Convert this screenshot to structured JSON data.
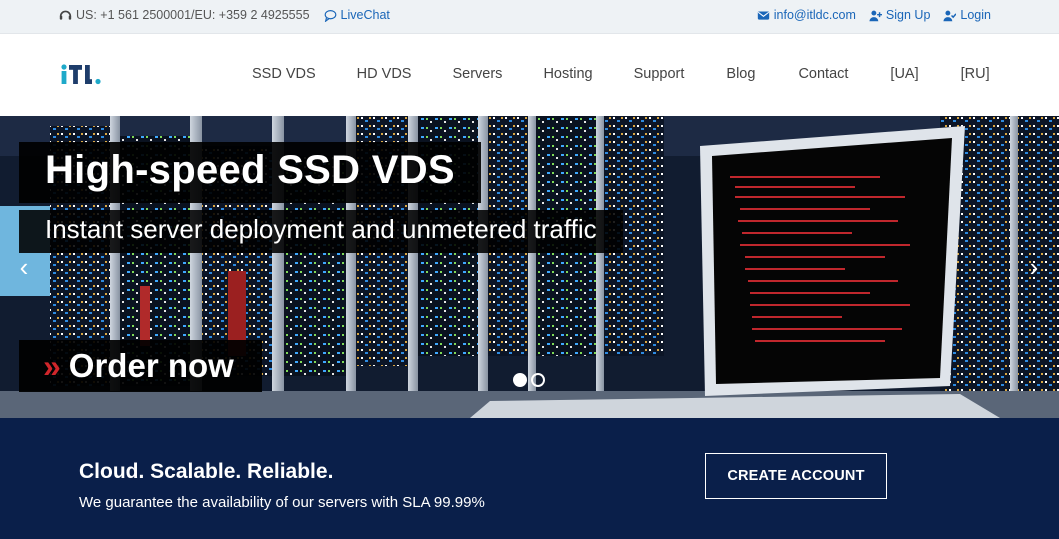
{
  "topbar": {
    "phone": "US: +1 561 2500001/EU: +359 2 4925555",
    "livechat": "LiveChat",
    "email": "info@itldc.com",
    "signup": "Sign Up",
    "login": "Login"
  },
  "nav": {
    "items": [
      "SSD VDS",
      "HD VDS",
      "Servers",
      "Hosting",
      "Support",
      "Blog",
      "Contact",
      "[UA]",
      "[RU]"
    ]
  },
  "hero": {
    "headline": "High-speed SSD VDS",
    "subline": "Instant server deployment and unmetered traffic",
    "order": "Order now",
    "prev": "‹",
    "next": "›",
    "slide_count": 2,
    "active_slide": 1
  },
  "banner": {
    "title": "Cloud. Scalable. Reliable.",
    "desc": "We guarantee the availability of our servers with SLA 99.99%",
    "cta": "CREATE ACCOUNT"
  },
  "colors": {
    "accent": "#1a66b8",
    "banner_bg": "#0a1f4a",
    "logo_teal": "#1ea9c9",
    "chevron_red": "#d0262b"
  }
}
